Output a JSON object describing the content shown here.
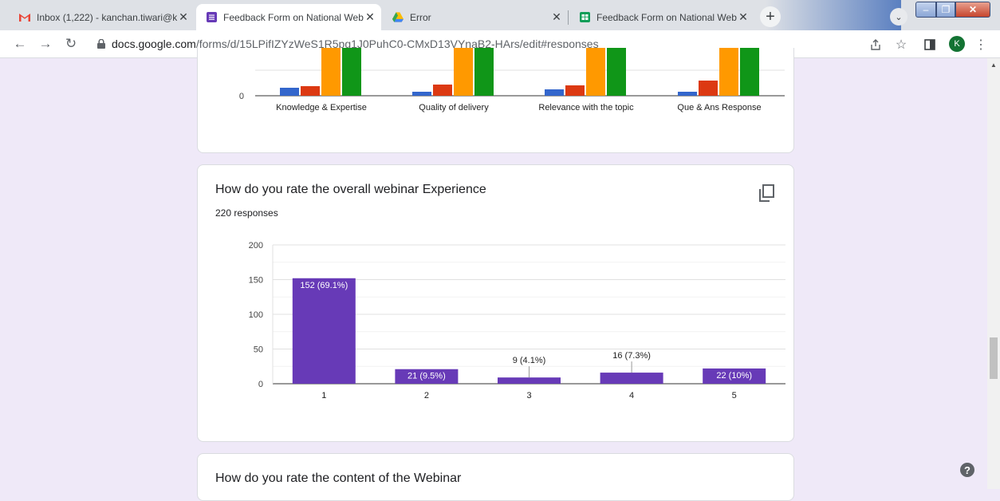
{
  "tabs": [
    {
      "title": "Inbox (1,222) - kanchan.tiwari@k",
      "icon": "gmail-icon",
      "active": false
    },
    {
      "title": "Feedback Form on National Web",
      "icon": "forms-icon",
      "active": true
    },
    {
      "title": "Error",
      "icon": "drive-icon",
      "active": false
    },
    {
      "title": "Feedback Form on National Web",
      "icon": "sheets-icon",
      "active": false
    }
  ],
  "address_bar": {
    "domain": "docs.google.com",
    "path": "/forms/d/15LPjfIZYzWeS1R5pg1J0PuhC0-CMxD13VYnaB2-HArs/edit#responses"
  },
  "profile": {
    "initial": "K",
    "color": "#137333"
  },
  "top_chart": {
    "chart_data": {
      "type": "bar",
      "categories": [
        "Knowledge & Expertise",
        "Quality of delivery",
        "Relevance with the topic",
        "Que & Ans Response"
      ],
      "series_colors": [
        "#3366cc",
        "#dc3912",
        "#ff9900",
        "#109618"
      ],
      "zero_label": "0"
    }
  },
  "question": {
    "title": "How do you rate the overall webinar Experience",
    "responses": "220 responses",
    "chart_data": {
      "type": "bar",
      "categories": [
        "1",
        "2",
        "3",
        "4",
        "5"
      ],
      "values": [
        152,
        21,
        9,
        16,
        22
      ],
      "data_labels": [
        "152 (69.1%)",
        "21 (9.5%)",
        "9 (4.1%)",
        "16 (7.3%)",
        "22 (10%)"
      ],
      "yticks": [
        "0",
        "50",
        "100",
        "150",
        "200"
      ],
      "ylim": [
        0,
        200
      ],
      "bar_color": "#673ab7",
      "grid": true
    }
  },
  "next_question": {
    "title": "How do you rate the content of the Webinar"
  }
}
